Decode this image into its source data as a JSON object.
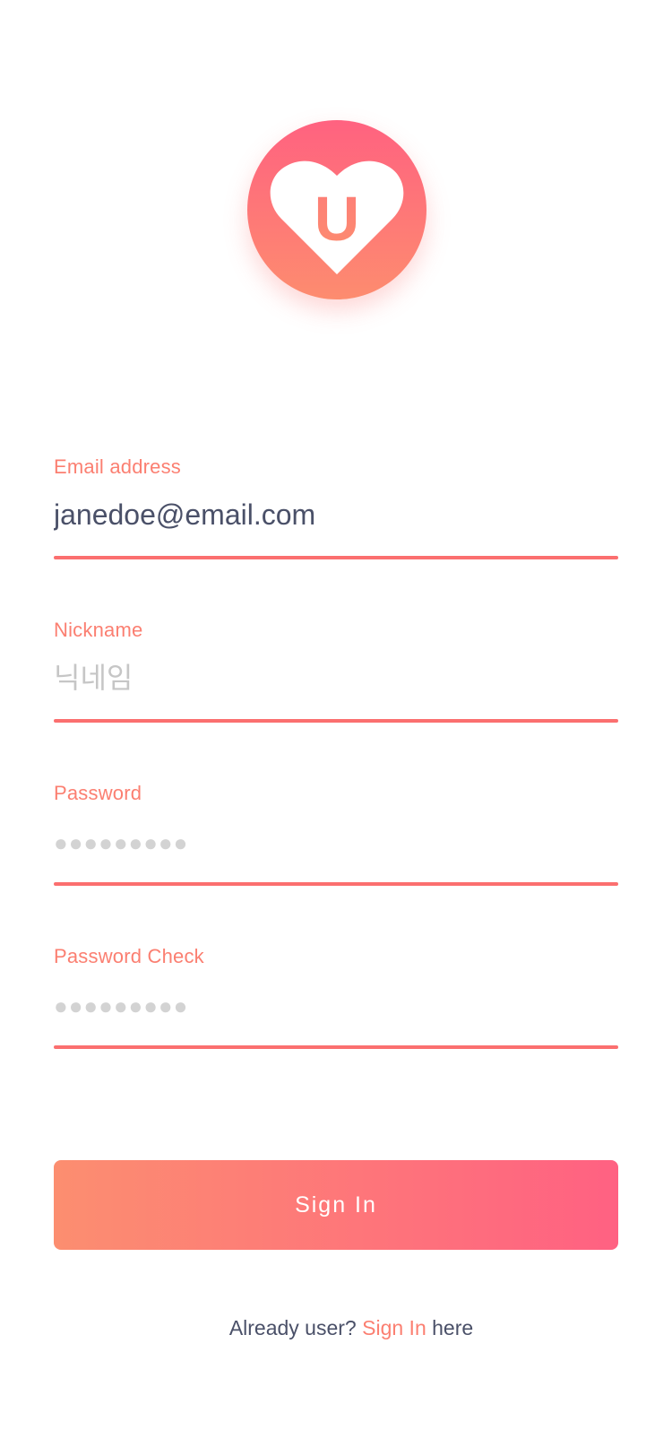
{
  "logo": {
    "letter": "U",
    "colors": {
      "top": "#ff6280",
      "bottom": "#fd8c6f"
    }
  },
  "form": {
    "email": {
      "label": "Email address",
      "value": "janedoe@email.com",
      "placeholder": ""
    },
    "nickname": {
      "label": "Nickname",
      "value": "",
      "placeholder": "닉네임"
    },
    "password": {
      "label": "Password",
      "value": "",
      "placeholder": "●●●●●●●●●"
    },
    "password_check": {
      "label": "Password Check",
      "value": "",
      "placeholder": "●●●●●●●●●"
    }
  },
  "actions": {
    "signin_label": "Sign In"
  },
  "footer": {
    "prefix": "Already user?",
    "link": "Sign In",
    "suffix": "here"
  },
  "colors": {
    "accent": "#fb7f71",
    "underline": "#fb6f6f",
    "button_start": "#fc8e70",
    "button_end": "#ff6182",
    "text": "#4a5068"
  }
}
